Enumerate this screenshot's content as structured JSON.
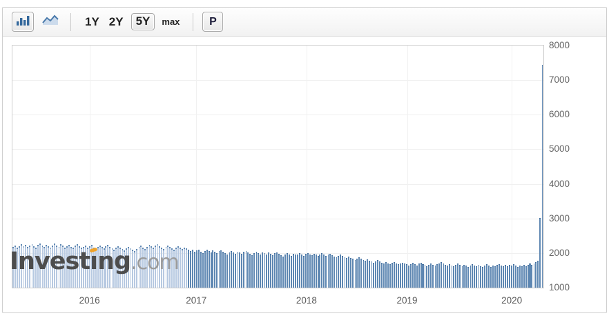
{
  "toolbar": {
    "chart_types": [
      {
        "name": "bar-chart",
        "selected": true
      },
      {
        "name": "line-chart",
        "selected": false
      }
    ],
    "ranges": {
      "r1": "1Y",
      "r2": "2Y",
      "r3": "5Y",
      "r4": "max",
      "selected": "5Y"
    },
    "p_button_label": "P"
  },
  "watermark": {
    "brand": "Investing",
    "suffix": ".com"
  },
  "colors": {
    "bar_dark": "#5e87b2",
    "bar_dark_edge": "#426f9f",
    "bar_light": "#b7c9e1",
    "bar_light_cap": "#5e87b2",
    "gridline": "#f0f0f0",
    "plot_border": "#cccccc",
    "axis_text": "#666666",
    "icon_blue": "#34689c",
    "logo_accent_orange": "#f0a32a"
  },
  "chart_data": {
    "type": "bar",
    "title": "",
    "xlabel": "",
    "ylabel": "",
    "frequency": "weekly",
    "x_range": [
      "2015-05",
      "2020-04"
    ],
    "x_axis_years": [
      "2016",
      "2017",
      "2018",
      "2019",
      "2020"
    ],
    "year_fractions": [
      0.1452,
      0.3463,
      0.5538,
      0.7432,
      0.9404
    ],
    "y_ticks": [
      8000,
      7000,
      6000,
      5000,
      4000,
      3000,
      2000,
      1000
    ],
    "ylim": [
      1000,
      8000
    ],
    "grid": true,
    "legend": "none",
    "light_bar_count": 85,
    "peak_value": 7440,
    "values": [
      2180,
      2220,
      2160,
      2200,
      2250,
      2190,
      2230,
      2170,
      2210,
      2260,
      2200,
      2150,
      2230,
      2280,
      2210,
      2170,
      2240,
      2200,
      2160,
      2220,
      2270,
      2210,
      2180,
      2250,
      2220,
      2160,
      2200,
      2240,
      2180,
      2150,
      2210,
      2250,
      2190,
      2160,
      2170,
      2210,
      2150,
      2190,
      2230,
      2160,
      2120,
      2180,
      2220,
      2170,
      2130,
      2190,
      2240,
      2180,
      2140,
      2100,
      2160,
      2200,
      2150,
      2110,
      2070,
      2130,
      2180,
      2140,
      2100,
      2060,
      2120,
      2170,
      2210,
      2160,
      2120,
      2180,
      2230,
      2190,
      2150,
      2210,
      2250,
      2200,
      2160,
      2120,
      2170,
      2220,
      2180,
      2140,
      2100,
      2150,
      2190,
      2150,
      2110,
      2160,
      2130,
      2100,
      2050,
      2090,
      2030,
      2070,
      2100,
      2040,
      2000,
      2060,
      2090,
      2050,
      2010,
      2070,
      2030,
      1990,
      2050,
      2080,
      2040,
      2000,
      1960,
      2020,
      2060,
      2020,
      1980,
      2040,
      2010,
      1970,
      2030,
      2060,
      2020,
      1980,
      1940,
      2000,
      2040,
      2000,
      1960,
      2020,
      1990,
      1950,
      2010,
      1970,
      1930,
      1990,
      2020,
      1980,
      1940,
      1900,
      1960,
      2000,
      1960,
      1920,
      1980,
      1950,
      1960,
      1990,
      1950,
      1920,
      1970,
      2000,
      1960,
      1930,
      1980,
      1950,
      1920,
      1960,
      1990,
      1950,
      1910,
      1950,
      1980,
      1940,
      1900,
      1870,
      1920,
      1950,
      1910,
      1880,
      1850,
      1890,
      1860,
      1830,
      1800,
      1840,
      1870,
      1830,
      1800,
      1770,
      1810,
      1780,
      1750,
      1720,
      1760,
      1790,
      1750,
      1720,
      1690,
      1730,
      1700,
      1670,
      1710,
      1740,
      1700,
      1670,
      1700,
      1720,
      1700,
      1670,
      1640,
      1680,
      1710,
      1670,
      1640,
      1690,
      1720,
      1680,
      1650,
      1620,
      1660,
      1700,
      1660,
      1630,
      1670,
      1700,
      1740,
      1700,
      1660,
      1630,
      1670,
      1640,
      1610,
      1650,
      1690,
      1650,
      1620,
      1660,
      1630,
      1600,
      1640,
      1680,
      1640,
      1610,
      1650,
      1620,
      1590,
      1630,
      1670,
      1630,
      1600,
      1640,
      1610,
      1650,
      1680,
      1640,
      1610,
      1650,
      1620,
      1660,
      1640,
      1670,
      1630,
      1600,
      1640,
      1610,
      1650,
      1620,
      1660,
      1700,
      1660,
      1700,
      1730,
      1770,
      3020,
      7440
    ]
  }
}
